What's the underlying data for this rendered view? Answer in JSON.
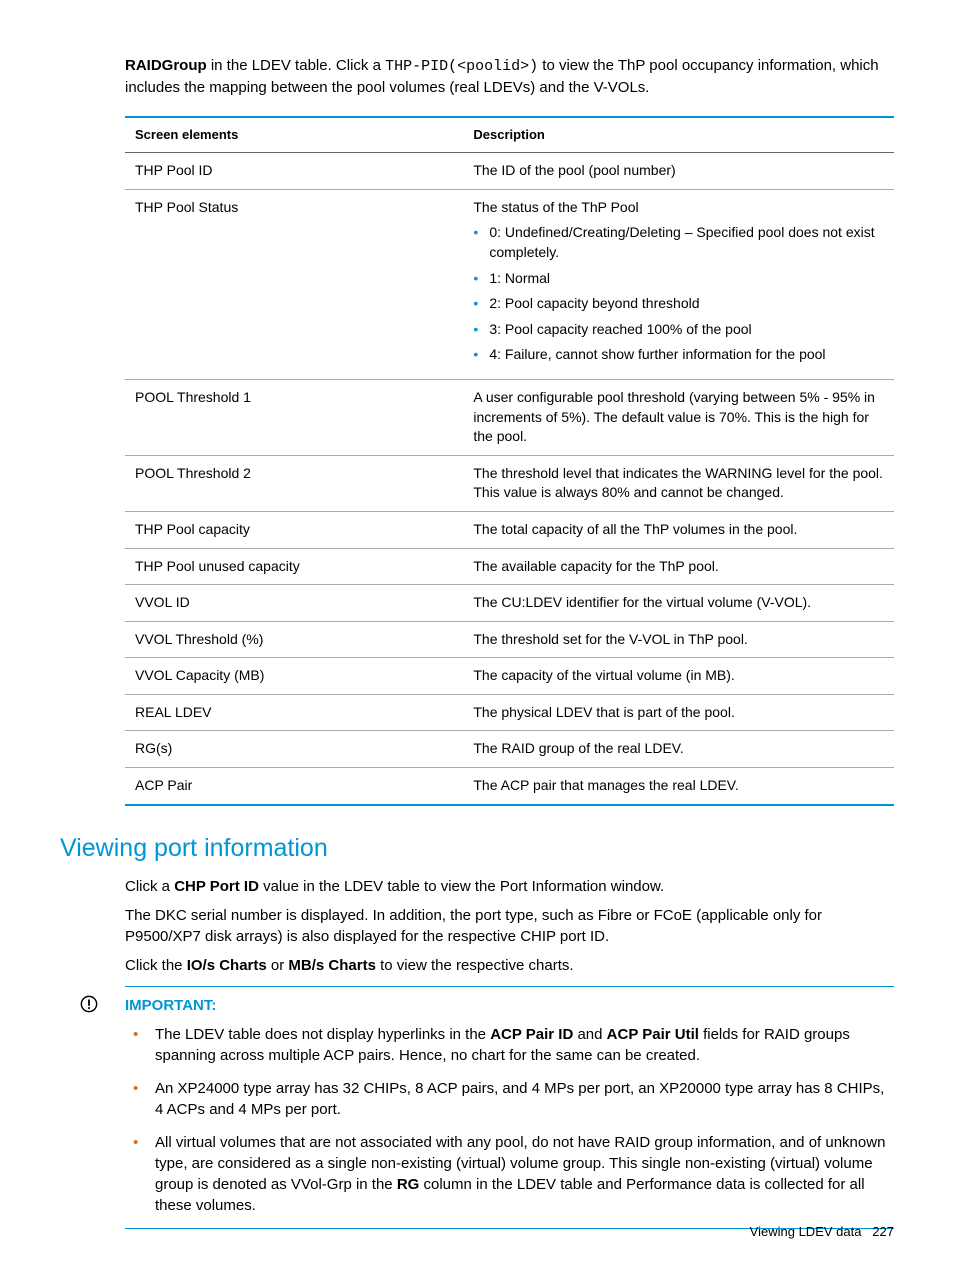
{
  "intro": {
    "bold_lead": "RAIDGroup",
    "pre_code": " in the LDEV table. Click a ",
    "code": "THP-PID(<poolid>)",
    "post_code": " to view the ThP pool occupancy information, which includes the mapping between the pool volumes (real LDEVs) and the V-VOLs."
  },
  "table": {
    "head": {
      "col1": "Screen elements",
      "col2": "Description"
    },
    "rows": [
      {
        "c1": "THP Pool ID",
        "c2": "The ID of the pool (pool number)"
      },
      {
        "c1": "THP Pool Status",
        "c2": "The status of the ThP Pool",
        "list": [
          "0: Undefined/Creating/Deleting – Specified pool does not exist completely.",
          "1: Normal",
          "2: Pool capacity beyond threshold",
          "3: Pool capacity reached 100% of the pool",
          "4: Failure, cannot show further information for the pool"
        ]
      },
      {
        "c1": "POOL Threshold 1",
        "c2": "A user configurable pool threshold (varying between 5% - 95% in increments of 5%). The default value is 70%. This is the high for the pool."
      },
      {
        "c1": "POOL Threshold 2",
        "c2": "The threshold level that indicates the WARNING level for the pool. This value is always 80% and cannot be changed."
      },
      {
        "c1": "THP Pool capacity",
        "c2": "The total capacity of all the ThP volumes in the pool."
      },
      {
        "c1": "THP Pool unused capacity",
        "c2": "The available capacity for the ThP pool."
      },
      {
        "c1": "VVOL ID",
        "c2": "The CU:LDEV identifier for the virtual volume (V-VOL)."
      },
      {
        "c1": "VVOL Threshold (%)",
        "c2": "The threshold set for the V-VOL in ThP pool."
      },
      {
        "c1": "VVOL Capacity (MB)",
        "c2": "The capacity of the virtual volume (in MB)."
      },
      {
        "c1": "REAL LDEV",
        "c2": "The physical LDEV that is part of the pool."
      },
      {
        "c1": "RG(s)",
        "c2": "The RAID group of the real LDEV."
      },
      {
        "c1": "ACP Pair",
        "c2": "The ACP pair that manages the real LDEV."
      }
    ]
  },
  "section_heading": "Viewing port information",
  "port_p1": {
    "pre": "Click a ",
    "b1": "CHP Port ID",
    "post": " value in the LDEV table to view the Port Information window."
  },
  "port_p2": "The DKC serial number is displayed. In addition, the port type, such as Fibre or FCoE (applicable only for P9500/XP7 disk arrays) is also displayed for the respective CHIP port ID.",
  "port_p3": {
    "t1": "Click the ",
    "b1": "IO/s Charts",
    "t2": " or ",
    "b2": "MB/s Charts",
    "t3": " to view the respective charts."
  },
  "important": {
    "label": "IMPORTANT:",
    "items": [
      {
        "t1": "The LDEV table does not display hyperlinks in the ",
        "b1": "ACP Pair ID",
        "t2": " and ",
        "b2": "ACP Pair Util",
        "t3": " fields for RAID groups spanning across multiple ACP pairs. Hence, no chart for the same can be created."
      },
      {
        "plain": "An XP24000 type array has 32 CHIPs, 8 ACP pairs, and 4 MPs per port, an XP20000 type array has 8 CHIPs, 4 ACPs and 4 MPs per port."
      },
      {
        "t1": "All virtual volumes that are not associated with any pool, do not have RAID group information, and of unknown type, are considered as a single non-existing (virtual) volume group. This single non-existing (virtual) volume group is denoted as VVol-Grp in the ",
        "b1": "RG",
        "t3": " column in the LDEV table and Performance data is collected for all these volumes."
      }
    ]
  },
  "footer": {
    "text": "Viewing LDEV data",
    "page": "227"
  }
}
